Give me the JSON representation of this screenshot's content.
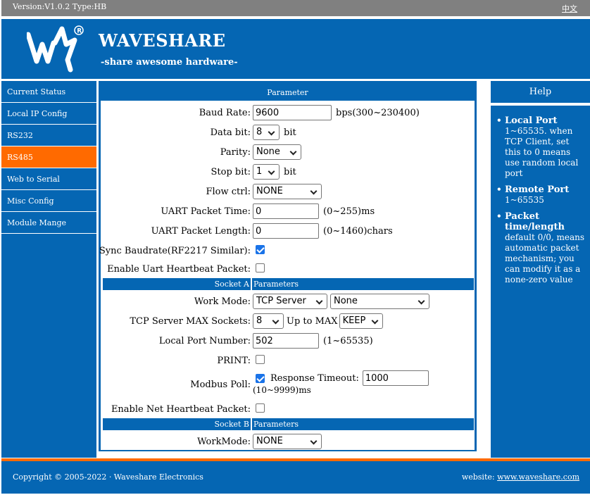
{
  "topbar": {
    "version": "Version:V1.0.2 Type:HB",
    "lang": "中文"
  },
  "header": {
    "brand": "WAVESHARE",
    "slogan": "-share awesome hardware-"
  },
  "sidebar": {
    "items": [
      {
        "label": "Current Status"
      },
      {
        "label": "Local IP Config"
      },
      {
        "label": "RS232"
      },
      {
        "label": "RS485"
      },
      {
        "label": "Web to Serial"
      },
      {
        "label": "Misc Config"
      },
      {
        "label": "Module Mange"
      }
    ],
    "active_index": 3
  },
  "main": {
    "title": "Parameter",
    "baud_rate": {
      "label": "Baud Rate:",
      "value": "9600",
      "unit": "bps(300~230400)"
    },
    "data_bit": {
      "label": "Data bit:",
      "value": "8",
      "unit": "bit"
    },
    "parity": {
      "label": "Parity:",
      "value": "None"
    },
    "stop_bit": {
      "label": "Stop bit:",
      "value": "1",
      "unit": "bit"
    },
    "flow_ctrl": {
      "label": "Flow ctrl:",
      "value": "NONE"
    },
    "uart_packet_time": {
      "label": "UART Packet Time:",
      "value": "0",
      "unit": "(0~255)ms"
    },
    "uart_packet_length": {
      "label": "UART Packet Length:",
      "value": "0",
      "unit": "(0~1460)chars"
    },
    "sync_baudrate": {
      "label": "Sync Baudrate(RF2217 Similar):",
      "checked": true
    },
    "uart_heartbeat": {
      "label": "Enable Uart Heartbeat Packet:",
      "checked": false
    },
    "socket_a": {
      "left": "Socket A",
      "right": "Parameters"
    },
    "work_mode": {
      "label": "Work Mode:",
      "value": "TCP Server",
      "value2": "None"
    },
    "max_sockets": {
      "label": "TCP Server MAX Sockets:",
      "value": "8",
      "mid": "Up to MAX",
      "value2": "KEEP"
    },
    "local_port": {
      "label": "Local Port Number:",
      "value": "502",
      "unit": "(1~65535)"
    },
    "print": {
      "label": "PRINT:",
      "checked": false
    },
    "modbus_poll": {
      "label": "Modbus Poll:",
      "checked": true,
      "timeout_label": "Response Timeout:",
      "timeout_value": "1000",
      "range": "(10~9999)ms"
    },
    "net_heartbeat": {
      "label": "Enable Net Heartbeat Packet:",
      "checked": false
    },
    "socket_b": {
      "left": "Socket B",
      "right": "Parameters"
    },
    "work_mode_b": {
      "label": "WorkMode:",
      "value": "NONE"
    }
  },
  "help": {
    "title": "Help",
    "items": [
      {
        "title": "Local Port",
        "text": "1~65535. when TCP Client, set this to 0 means use random local port"
      },
      {
        "title": "Remote Port",
        "text": "1~65535"
      },
      {
        "title": "Packet time/length",
        "text": "default 0/0, means automatic packet mechanism; you can modify it as a none-zero value"
      }
    ]
  },
  "footer": {
    "copyright": "Copyright © 2005-2022 · Waveshare Electronics",
    "website_label": "website:",
    "website_link": "www.waveshare.com"
  },
  "colors": {
    "primary": "#0566b3",
    "accent": "#ff6a00",
    "topbar": "#808080"
  }
}
